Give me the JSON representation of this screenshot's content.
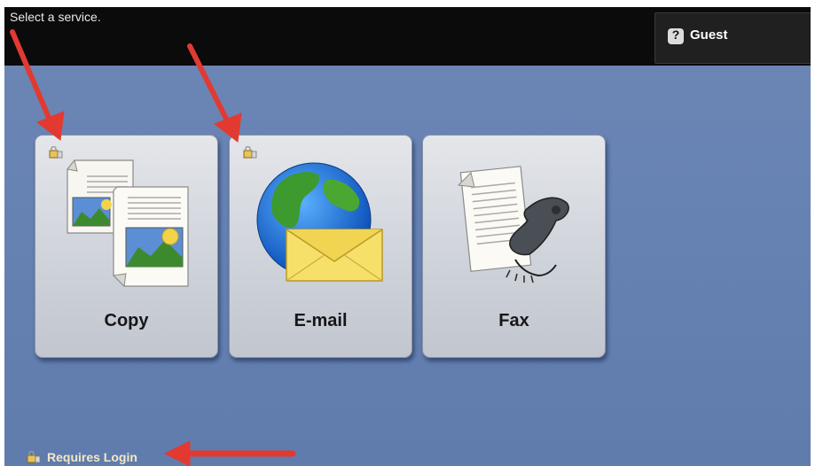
{
  "header": {
    "prompt": "Select a service.",
    "user_label": "Guest"
  },
  "services": [
    {
      "label": "Copy",
      "requires_login": true
    },
    {
      "label": "E-mail",
      "requires_login": true
    },
    {
      "label": "Fax",
      "requires_login": false
    }
  ],
  "footer": {
    "legend_label": "Requires Login"
  },
  "colors": {
    "screen_blue": "#6783b4",
    "annotation_red": "#e23a31"
  }
}
